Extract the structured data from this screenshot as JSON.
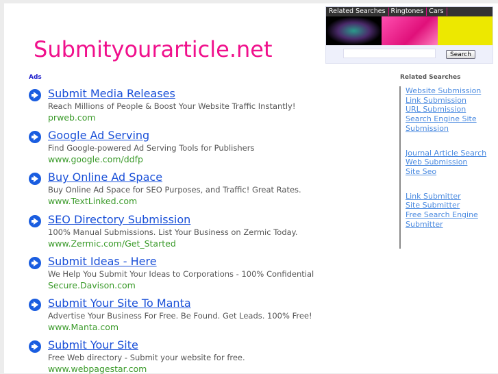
{
  "site_title": "Submityourarticle.net",
  "topnav": [
    "Related Searches",
    "Ringtones",
    "Cars"
  ],
  "search": {
    "button": "Search",
    "value": ""
  },
  "ads_label": "Ads",
  "ads": [
    {
      "title": "Submit Media Releases",
      "desc": "Reach Millions of People & Boost Your Website Traffic Instantly!",
      "url": "prweb.com"
    },
    {
      "title": "Google Ad Serving",
      "desc": "Find Google-powered Ad Serving Tools for Publishers",
      "url": "www.google.com/ddfp"
    },
    {
      "title": "Buy Online Ad Space",
      "desc": "Buy Online Ad Space for SEO Purposes, and Traffic! Great Rates.",
      "url": "www.TextLinked.com"
    },
    {
      "title": "SEO Directory Submission",
      "desc": "100% Manual Submissions. List Your Business on Zermic Today.",
      "url": "www.Zermic.com/Get_Started"
    },
    {
      "title": "Submit Ideas - Here",
      "desc": "We Help You Submit Your Ideas to Corporations - 100% Confidential",
      "url": "Secure.Davison.com"
    },
    {
      "title": "Submit Your Site To Manta",
      "desc": "Advertise Your Business For Free. Be Found. Get Leads. 100% Free!",
      "url": "www.Manta.com"
    },
    {
      "title": "Submit Your Site",
      "desc": "Free Web directory - Submit your website for free.",
      "url": "www.webpagestar.com"
    }
  ],
  "related": {
    "title": "Related Searches",
    "groups": [
      [
        "Website Submission",
        "Link Submission",
        "URL Submission",
        "Search Engine Site Submission"
      ],
      [
        "Journal Article Search",
        "Web Submission",
        "Site Seo"
      ],
      [
        "Link Submitter",
        "Site Submitter",
        "Free Search Engine Submitter"
      ]
    ]
  }
}
